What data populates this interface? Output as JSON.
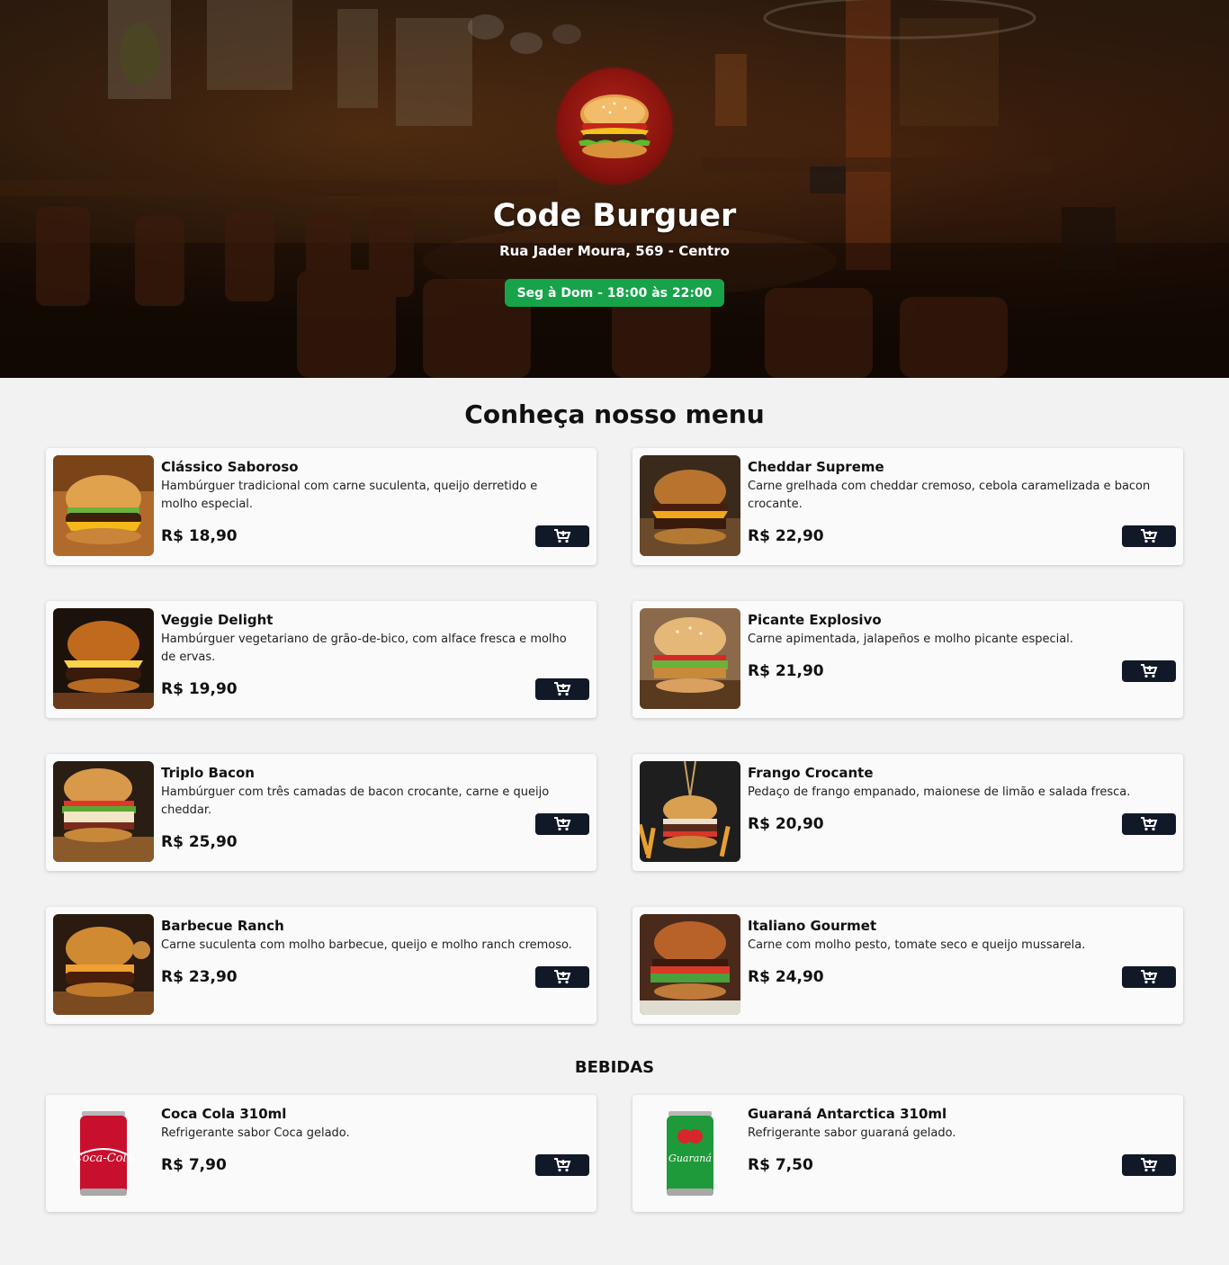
{
  "header": {
    "brand": "Code Burguer",
    "address": "Rua Jader Moura, 569 - Centro",
    "hours": "Seg à Dom - 18:00 às 22:00",
    "hours_color": "#16a34a"
  },
  "menu": {
    "title": "Conheça nosso menu",
    "items": [
      {
        "name": "Clássico Saboroso",
        "description": "Hambúrguer tradicional com carne suculenta, queijo derretido e molho especial.",
        "price": "R$ 18,90"
      },
      {
        "name": "Cheddar Supreme",
        "description": "Carne grelhada com cheddar cremoso, cebola caramelizada e bacon crocante.",
        "price": "R$ 22,90"
      },
      {
        "name": "Veggie Delight",
        "description": "Hambúrguer vegetariano de grão-de-bico, com alface fresca e molho de ervas.",
        "price": "R$ 19,90"
      },
      {
        "name": "Picante Explosivo",
        "description": "Carne apimentada, jalapeños e molho picante especial.",
        "price": "R$ 21,90"
      },
      {
        "name": "Triplo Bacon",
        "description": "Hambúrguer com três camadas de bacon crocante, carne e queijo cheddar.",
        "price": "R$ 25,90"
      },
      {
        "name": "Frango Crocante",
        "description": "Pedaço de frango empanado, maionese de limão e salada fresca.",
        "price": "R$ 20,90"
      },
      {
        "name": "Barbecue Ranch",
        "description": "Carne suculenta com molho barbecue, queijo e molho ranch cremoso.",
        "price": "R$ 23,90"
      },
      {
        "name": "Italiano Gourmet",
        "description": "Carne com molho pesto, tomate seco e queijo mussarela.",
        "price": "R$ 24,90"
      }
    ]
  },
  "drinks": {
    "title": "BEBIDAS",
    "items": [
      {
        "name": "Coca Cola 310ml",
        "description": "Refrigerante sabor Coca gelado.",
        "price": "R$ 7,90",
        "can_color": "#c8102e",
        "can_label": "Coca-Cola"
      },
      {
        "name": "Guaraná Antarctica 310ml",
        "description": "Refrigerante sabor guaraná gelado.",
        "price": "R$ 7,50",
        "can_color": "#1f9a3a",
        "can_label": "Guaraná"
      }
    ]
  },
  "icons": {
    "cart": "cart-plus-icon"
  },
  "colors": {
    "button": "#111827",
    "background": "#f2f2f2",
    "card": "#fafafa"
  }
}
